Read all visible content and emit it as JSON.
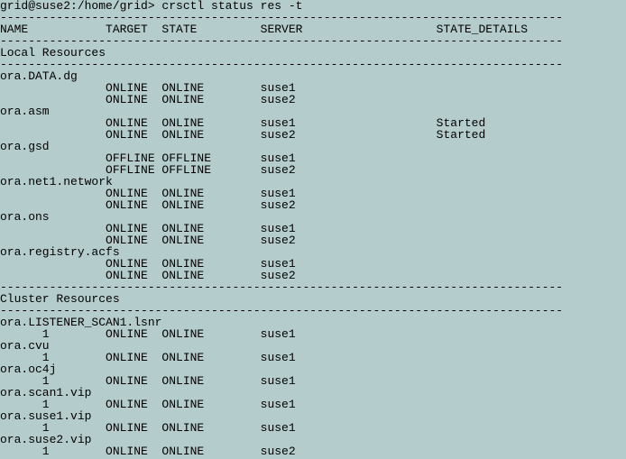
{
  "prompt": "grid@suse2:/home/grid> ",
  "command": "crsctl status res -t",
  "sep": "--------------------------------------------------------------------------------",
  "header": {
    "name": "NAME",
    "target": "TARGET",
    "state": "STATE",
    "server": "SERVER",
    "details": "STATE_DETAILS"
  },
  "sections": [
    {
      "title": "Local Resources",
      "items": [
        {
          "name": "ora.DATA.dg",
          "rows": [
            {
              "inst": "",
              "target": "ONLINE",
              "state": "ONLINE",
              "server": "suse1",
              "details": ""
            },
            {
              "inst": "",
              "target": "ONLINE",
              "state": "ONLINE",
              "server": "suse2",
              "details": ""
            }
          ]
        },
        {
          "name": "ora.asm",
          "rows": [
            {
              "inst": "",
              "target": "ONLINE",
              "state": "ONLINE",
              "server": "suse1",
              "details": "Started"
            },
            {
              "inst": "",
              "target": "ONLINE",
              "state": "ONLINE",
              "server": "suse2",
              "details": "Started"
            }
          ]
        },
        {
          "name": "ora.gsd",
          "rows": [
            {
              "inst": "",
              "target": "OFFLINE",
              "state": "OFFLINE",
              "server": "suse1",
              "details": ""
            },
            {
              "inst": "",
              "target": "OFFLINE",
              "state": "OFFLINE",
              "server": "suse2",
              "details": ""
            }
          ]
        },
        {
          "name": "ora.net1.network",
          "rows": [
            {
              "inst": "",
              "target": "ONLINE",
              "state": "ONLINE",
              "server": "suse1",
              "details": ""
            },
            {
              "inst": "",
              "target": "ONLINE",
              "state": "ONLINE",
              "server": "suse2",
              "details": ""
            }
          ]
        },
        {
          "name": "ora.ons",
          "rows": [
            {
              "inst": "",
              "target": "ONLINE",
              "state": "ONLINE",
              "server": "suse1",
              "details": ""
            },
            {
              "inst": "",
              "target": "ONLINE",
              "state": "ONLINE",
              "server": "suse2",
              "details": ""
            }
          ]
        },
        {
          "name": "ora.registry.acfs",
          "rows": [
            {
              "inst": "",
              "target": "ONLINE",
              "state": "ONLINE",
              "server": "suse1",
              "details": ""
            },
            {
              "inst": "",
              "target": "ONLINE",
              "state": "ONLINE",
              "server": "suse2",
              "details": ""
            }
          ]
        }
      ]
    },
    {
      "title": "Cluster Resources",
      "items": [
        {
          "name": "ora.LISTENER_SCAN1.lsnr",
          "rows": [
            {
              "inst": "1",
              "target": "ONLINE",
              "state": "ONLINE",
              "server": "suse1",
              "details": ""
            }
          ]
        },
        {
          "name": "ora.cvu",
          "rows": [
            {
              "inst": "1",
              "target": "ONLINE",
              "state": "ONLINE",
              "server": "suse1",
              "details": ""
            }
          ]
        },
        {
          "name": "ora.oc4j",
          "rows": [
            {
              "inst": "1",
              "target": "ONLINE",
              "state": "ONLINE",
              "server": "suse1",
              "details": ""
            }
          ]
        },
        {
          "name": "ora.scan1.vip",
          "rows": [
            {
              "inst": "1",
              "target": "ONLINE",
              "state": "ONLINE",
              "server": "suse1",
              "details": ""
            }
          ]
        },
        {
          "name": "ora.suse1.vip",
          "rows": [
            {
              "inst": "1",
              "target": "ONLINE",
              "state": "ONLINE",
              "server": "suse1",
              "details": ""
            }
          ]
        },
        {
          "name": "ora.suse2.vip",
          "rows": [
            {
              "inst": "1",
              "target": "ONLINE",
              "state": "ONLINE",
              "server": "suse2",
              "details": ""
            }
          ]
        }
      ]
    }
  ]
}
